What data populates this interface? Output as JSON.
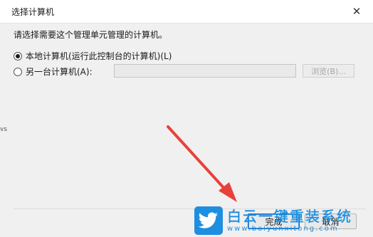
{
  "window": {
    "title": "选择计算机",
    "close_glyph": "✕"
  },
  "prompt": "请选择需要这个管理单元管理的计算机。",
  "options": {
    "local": {
      "label": "本地计算机(运行此控制台的计算机)(L)",
      "selected": true
    },
    "other": {
      "label": "另一台计算机(A):",
      "selected": false
    }
  },
  "computer_input": {
    "value": ""
  },
  "browse_label": "浏览(B)...",
  "stub_text": "vs",
  "buttons": {
    "finish": "完成",
    "cancel": "取消"
  },
  "watermark": {
    "title": "白云一键重装系统",
    "url": "www.baiyunxitong.com",
    "logo_icon": "twitter-bird-icon"
  },
  "colors": {
    "arrow": "#e8413a",
    "watermark": "#1e8fe0",
    "focus": "#0067c0"
  }
}
